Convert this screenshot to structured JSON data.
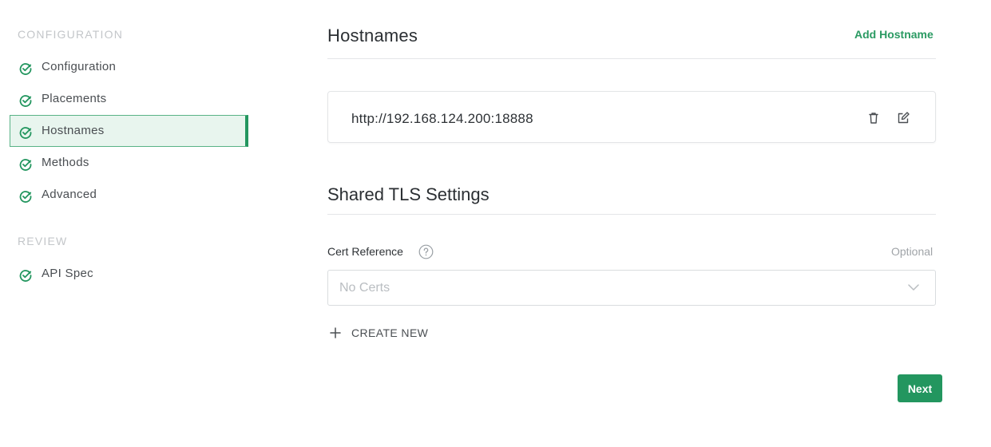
{
  "sidebar": {
    "sections": [
      {
        "title": "CONFIGURATION",
        "items": [
          {
            "label": "Configuration",
            "status": "check-circle-icon",
            "active": false
          },
          {
            "label": "Placements",
            "status": "check-circle-icon",
            "active": false
          },
          {
            "label": "Hostnames",
            "status": "check-circle-icon",
            "active": true
          },
          {
            "label": "Methods",
            "status": "check-circle-icon",
            "active": false
          },
          {
            "label": "Advanced",
            "status": "check-circle-icon",
            "active": false
          }
        ]
      },
      {
        "title": "REVIEW",
        "items": [
          {
            "label": "API Spec",
            "status": "check-circle-icon",
            "active": false
          }
        ]
      }
    ]
  },
  "hostnames": {
    "title": "Hostnames",
    "add_label": "Add Hostname",
    "items": [
      {
        "url": "http://192.168.124.200:18888",
        "actions": [
          "trash-icon",
          "edit-icon"
        ]
      }
    ]
  },
  "tls": {
    "title": "Shared TLS Settings",
    "cert_label": "Cert Reference",
    "optional_label": "Optional",
    "select_placeholder": "No Certs",
    "create_new_label": "CREATE NEW"
  },
  "footer": {
    "next_label": "Next"
  },
  "colors": {
    "accent": "#23965f",
    "accent_light": "#e8f5ee",
    "link": "#2a9a62"
  }
}
